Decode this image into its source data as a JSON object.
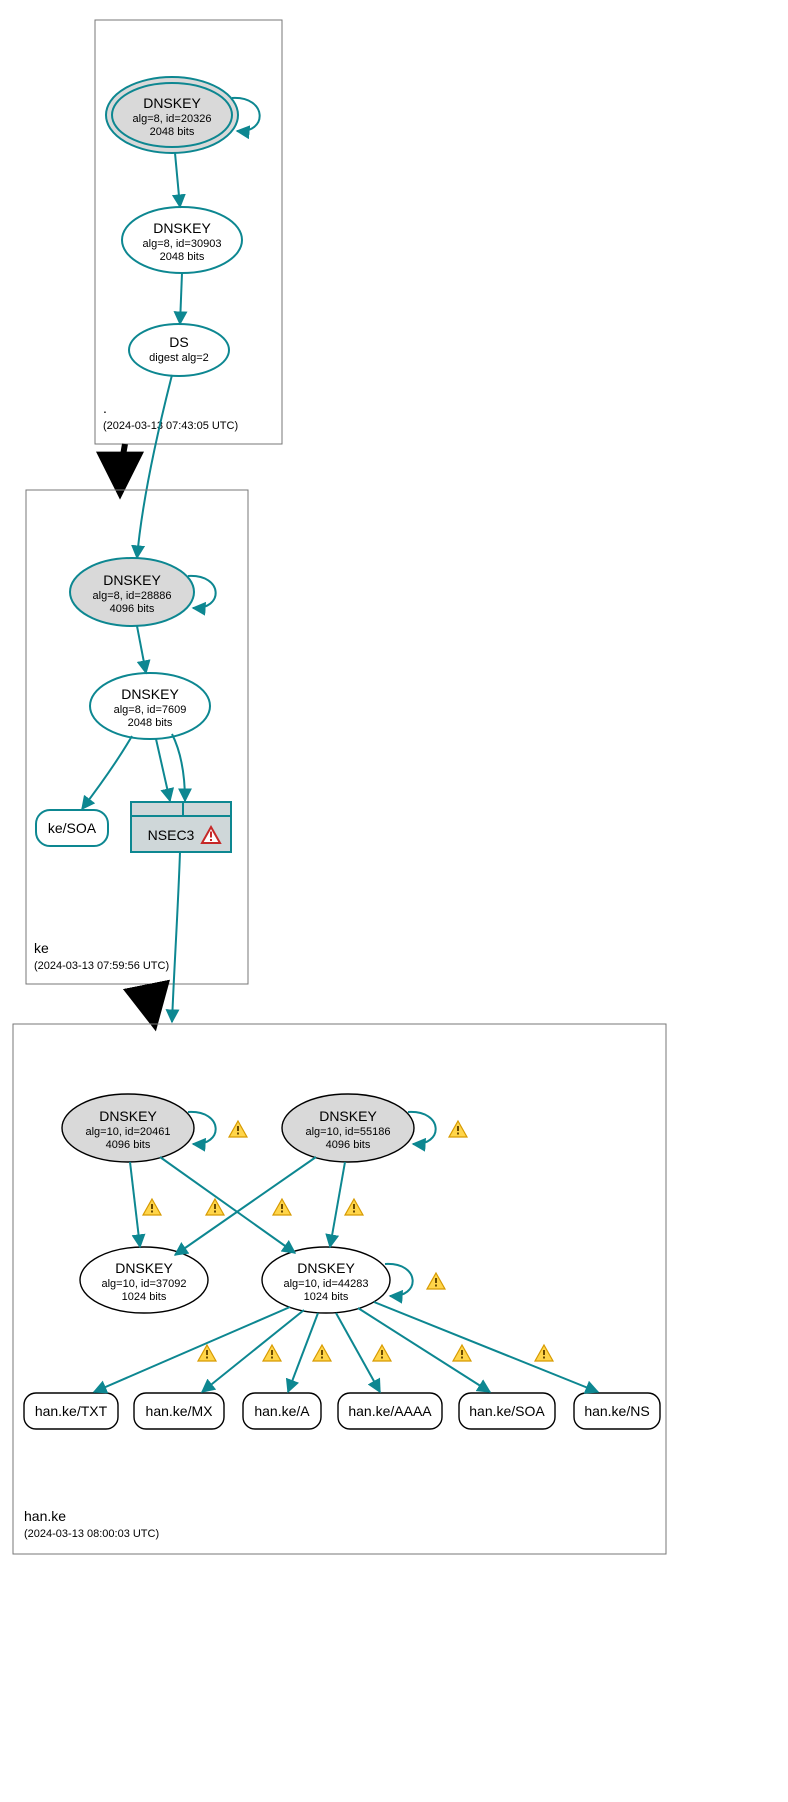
{
  "colors": {
    "teal": "#0d8791",
    "gray_fill": "#d9d9d9",
    "nsec_fill": "#cfd7d9",
    "black": "#000000"
  },
  "zones": {
    "root": {
      "label": ".",
      "timestamp": "(2024-03-13 07:43:05 UTC)",
      "ksk": {
        "title": "DNSKEY",
        "sub1": "alg=8, id=20326",
        "sub2": "2048 bits"
      },
      "zsk": {
        "title": "DNSKEY",
        "sub1": "alg=8, id=30903",
        "sub2": "2048 bits"
      },
      "ds": {
        "title": "DS",
        "sub1": "digest alg=2"
      }
    },
    "ke": {
      "label": "ke",
      "timestamp": "(2024-03-13 07:59:56 UTC)",
      "ksk": {
        "title": "DNSKEY",
        "sub1": "alg=8, id=28886",
        "sub2": "4096 bits"
      },
      "zsk": {
        "title": "DNSKEY",
        "sub1": "alg=8, id=7609",
        "sub2": "2048 bits"
      },
      "soa": "ke/SOA",
      "nsec3": "NSEC3"
    },
    "hanke": {
      "label": "han.ke",
      "timestamp": "(2024-03-13 08:00:03 UTC)",
      "ksk1": {
        "title": "DNSKEY",
        "sub1": "alg=10, id=20461",
        "sub2": "4096 bits"
      },
      "ksk2": {
        "title": "DNSKEY",
        "sub1": "alg=10, id=55186",
        "sub2": "4096 bits"
      },
      "zsk1": {
        "title": "DNSKEY",
        "sub1": "alg=10, id=37092",
        "sub2": "1024 bits"
      },
      "zsk2": {
        "title": "DNSKEY",
        "sub1": "alg=10, id=44283",
        "sub2": "1024 bits"
      },
      "rr": {
        "txt": "han.ke/TXT",
        "mx": "han.ke/MX",
        "a": "han.ke/A",
        "aaaa": "han.ke/AAAA",
        "soa": "han.ke/SOA",
        "ns": "han.ke/NS"
      }
    }
  }
}
